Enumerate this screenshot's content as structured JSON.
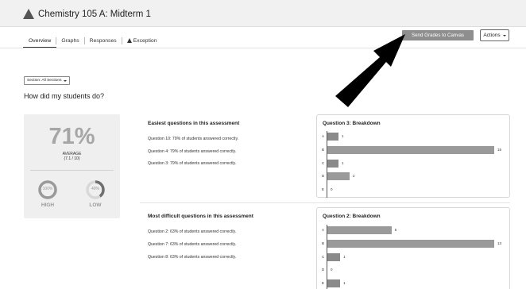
{
  "header": {
    "title": "Chemistry 105 A: Midterm 1"
  },
  "tabs": [
    "Overview",
    "Graphs",
    "Responses",
    "Exception"
  ],
  "buttons": {
    "send_grades": "Send Grades to Canvas",
    "actions": "Actions"
  },
  "section_select": "Section: All Sections",
  "heading": "How did my students do?",
  "average": {
    "percent": "71%",
    "label": "AVERAGE",
    "sub": "(7.1 / 10)"
  },
  "rings": {
    "high": {
      "value": "100%",
      "label": "HIGH",
      "fraction": 1.0
    },
    "low": {
      "value": "40%",
      "label": "LOW",
      "fraction": 0.4
    }
  },
  "easiest": {
    "title": "Easiest questions in this assessment",
    "items": [
      "Question 10: 79% of students answered correctly.",
      "Question 4: 79% of students answered correctly.",
      "Question 3: 79% of students answered correctly."
    ]
  },
  "hardest": {
    "title": "Most difficult questions in this assessment",
    "items": [
      "Question 2: 63% of students answered correctly.",
      "Question 7: 63% of students answered correctly.",
      "Question 8: 63% of students answered correctly."
    ]
  },
  "chart_data": [
    {
      "type": "bar",
      "title": "Question 3: Breakdown",
      "categories": [
        "A",
        "B",
        "C",
        "D",
        "E"
      ],
      "values": [
        1,
        15,
        1,
        2,
        0
      ],
      "xlim": [
        0,
        15
      ]
    },
    {
      "type": "bar",
      "title": "Question 2: Breakdown",
      "categories": [
        "A",
        "B",
        "C",
        "D",
        "E"
      ],
      "values": [
        5,
        13,
        1,
        0,
        1
      ],
      "xlim": [
        0,
        13
      ]
    }
  ]
}
